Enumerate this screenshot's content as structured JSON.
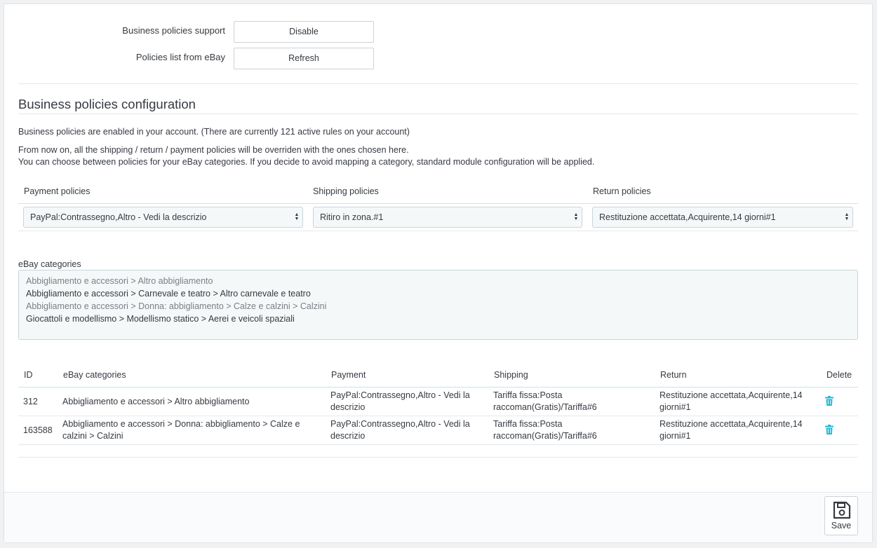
{
  "form": {
    "support_label": "Business policies support",
    "support_button": "Disable",
    "list_label": "Policies list from eBay",
    "list_button": "Refresh"
  },
  "section": {
    "title": "Business policies configuration",
    "info_line": "Business policies are enabled in your account. (There are currently 121 active rules on your account)",
    "desc_line1": "From now on, all the shipping / return / payment policies will be overriden with the ones chosen here.",
    "desc_line2": "You can choose between policies for your eBay categories. If you decide to avoid mapping a category, standard module configuration will be applied."
  },
  "policies": {
    "payment_header": "Payment policies",
    "shipping_header": "Shipping policies",
    "return_header": "Return policies",
    "payment_value": "PayPal:Contrassegno,Altro - Vedi la descrizio",
    "shipping_value": "Ritiro in zona.#1",
    "return_value": "Restituzione accettata,Acquirente,14 giorni#1"
  },
  "categories": {
    "label": "eBay categories",
    "items": [
      "Abbigliamento e accessori > Altro abbigliamento",
      "Abbigliamento e accessori > Carnevale e teatro > Altro carnevale e teatro",
      "Abbigliamento e accessori > Donna: abbigliamento > Calze e calzini > Calzini",
      "Giocattoli e modellismo > Modellismo statico > Aerei e veicoli spaziali"
    ]
  },
  "table": {
    "headers": {
      "id": "ID",
      "categories": "eBay categories",
      "payment": "Payment",
      "shipping": "Shipping",
      "return": "Return",
      "delete": "Delete"
    },
    "rows": [
      {
        "id": "312",
        "category": "Abbigliamento e accessori > Altro abbigliamento",
        "category_cont": "",
        "payment": "PayPal:Contrassegno,Altro - Vedi la",
        "payment_cont": "descrizio",
        "shipping": "Tariffa fissa:Posta",
        "shipping_cont": "raccoman(Gratis)/Tariffa#6",
        "return": "Restituzione accettata,Acquirente,14",
        "return_cont": "giorni#1"
      },
      {
        "id": "163588",
        "category": "Abbigliamento e accessori > Donna: abbigliamento > Calze e",
        "category_cont": "calzini > Calzini",
        "payment": "PayPal:Contrassegno,Altro - Vedi la",
        "payment_cont": "descrizio",
        "shipping": "Tariffa fissa:Posta",
        "shipping_cont": "raccoman(Gratis)/Tariffa#6",
        "return": "Restituzione accettata,Acquirente,14",
        "return_cont": "giorni#1"
      }
    ]
  },
  "footer": {
    "save_label": "Save"
  },
  "colors": {
    "accent": "#25b9d7",
    "text": "#363a41",
    "muted": "#7a7f86"
  },
  "icons": {
    "delete": "trash-icon",
    "save": "floppy-disk-icon",
    "select_caret": "updown-caret-icon"
  }
}
